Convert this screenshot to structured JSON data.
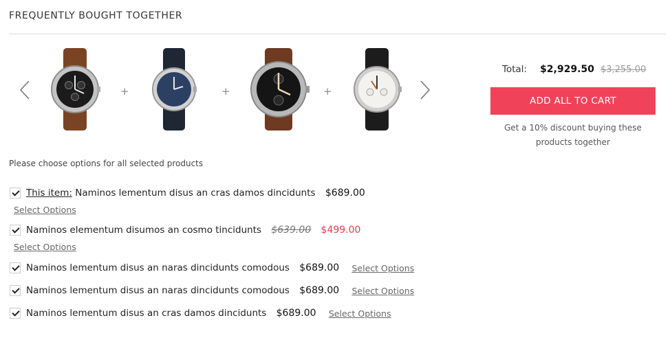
{
  "section": {
    "title": "FREQUENTLY BOUGHT TOGETHER"
  },
  "carousel": {
    "prev_icon": "chevron-left-icon",
    "next_icon": "chevron-right-icon",
    "plus": "+",
    "products": [
      {
        "icon": "chronograph-watch-brown-strap-icon"
      },
      {
        "icon": "navy-dial-watch-icon"
      },
      {
        "icon": "black-dial-watch-brown-strap-icon"
      },
      {
        "icon": "white-dial-watch-icon"
      }
    ]
  },
  "summary": {
    "total_label": "Total:",
    "total_price": "$2,929.50",
    "total_old_price": "$3,255.00",
    "add_button": "ADD ALL TO CART",
    "discount_note": "Get a 10% discount buying these products together",
    "accent_color": "#f0435a"
  },
  "choose_note": "Please choose options for all selected products",
  "items": [
    {
      "prefix": "This item:",
      "name": "Naminos lementum disus an cras damos dincidunts",
      "price": "$689.00",
      "options": "Select Options",
      "checked": true
    },
    {
      "name": "Naminos elementum disumos an cosmo tincidunts",
      "old_price": "$639.00",
      "price": "$499.00",
      "options": "Select Options",
      "checked": true
    },
    {
      "name": "Naminos lementum disus an naras dincidunts comodous",
      "price": "$689.00",
      "options": "Select Options",
      "checked": true
    },
    {
      "name": "Naminos lementum disus an naras dincidunts comodous",
      "price": "$689.00",
      "options": "Select Options",
      "checked": true
    },
    {
      "name": "Naminos lementum disus an cras damos dincidunts",
      "price": "$689.00",
      "options": "Select Options",
      "checked": true
    }
  ]
}
